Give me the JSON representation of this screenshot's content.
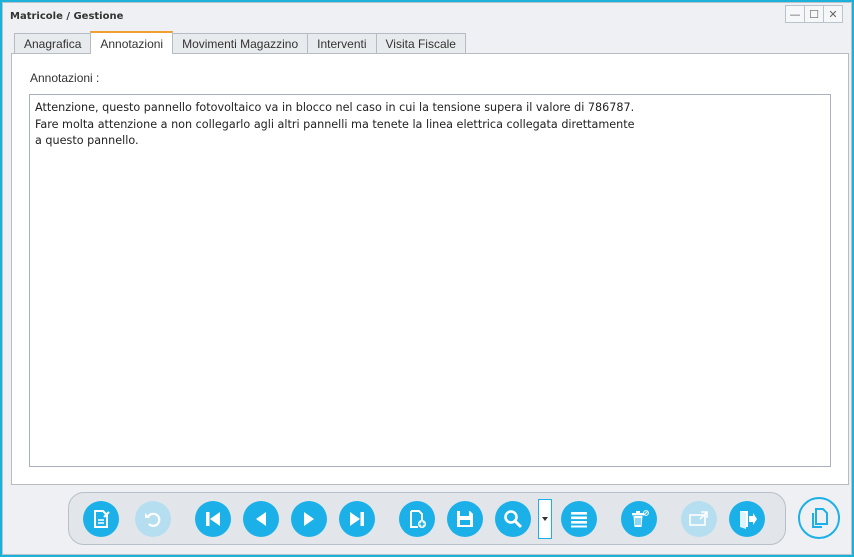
{
  "window": {
    "title": "Matricole / Gestione",
    "controls": {
      "minimize": "—",
      "maximize": "☐",
      "close": "✕"
    }
  },
  "tabs": [
    {
      "label": "Anagrafica",
      "active": false
    },
    {
      "label": "Annotazioni",
      "active": true
    },
    {
      "label": "Movimenti Magazzino",
      "active": false
    },
    {
      "label": "Interventi",
      "active": false
    },
    {
      "label": "Visita Fiscale",
      "active": false
    }
  ],
  "annotations": {
    "label": "Annotazioni :",
    "text": "Attenzione, questo pannello fotovoltaico va in blocco nel caso in cui la tensione supera il valore di 786787.\nFare molta attenzione a non collegarlo agli altri pannelli ma tenete la linea elettrica collegata direttamente\na questo pannello."
  },
  "toolbar": {
    "buttons": [
      {
        "name": "edit-note-button",
        "icon": "edit-document-icon",
        "enabled": true
      },
      {
        "name": "undo-button",
        "icon": "undo-icon",
        "enabled": false
      },
      {
        "name": "first-record-button",
        "icon": "first-icon",
        "enabled": true
      },
      {
        "name": "previous-record-button",
        "icon": "previous-icon",
        "enabled": true
      },
      {
        "name": "next-record-button",
        "icon": "next-icon",
        "enabled": true
      },
      {
        "name": "last-record-button",
        "icon": "last-icon",
        "enabled": true
      },
      {
        "name": "new-record-button",
        "icon": "new-document-icon",
        "enabled": true
      },
      {
        "name": "save-button",
        "icon": "save-icon",
        "enabled": true
      },
      {
        "name": "search-button",
        "icon": "search-icon",
        "enabled": true
      },
      {
        "name": "search-options-dropdown",
        "icon": "caret-down-icon",
        "enabled": true
      },
      {
        "name": "list-button",
        "icon": "list-icon",
        "enabled": true
      },
      {
        "name": "delete-button",
        "icon": "trash-icon",
        "enabled": true
      },
      {
        "name": "export-button",
        "icon": "folder-export-icon",
        "enabled": false
      },
      {
        "name": "exit-button",
        "icon": "exit-icon",
        "enabled": true
      }
    ],
    "side_button": {
      "name": "copy-button",
      "icon": "copy-icon"
    }
  },
  "colors": {
    "accent": "#1bb1e8",
    "accent_disabled": "#b5dff1",
    "tab_active_border": "#f0a030",
    "frame": "#1bb1d8"
  }
}
